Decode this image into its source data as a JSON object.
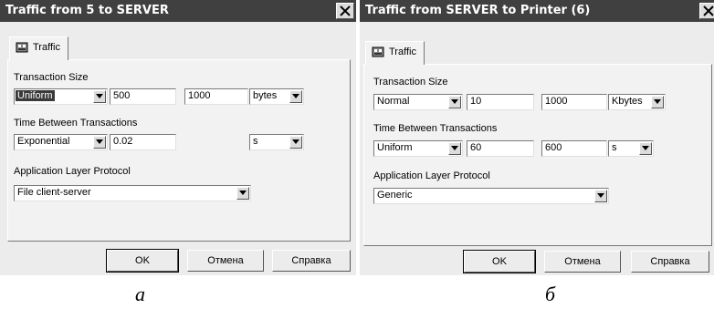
{
  "dialog_a": {
    "title": "Traffic from 5 to SERVER",
    "tab_label": "Traffic",
    "transaction_size_label": "Transaction Size",
    "size_distribution": "Uniform",
    "size_param1": "500",
    "size_param2": "1000",
    "size_unit": "bytes",
    "time_between_label": "Time Between Transactions",
    "time_distribution": "Exponential",
    "time_param1": "0.02",
    "time_unit": "s",
    "protocol_label": "Application Layer Protocol",
    "protocol_value": "File client-server",
    "ok_label": "OK",
    "cancel_label": "Отмена",
    "help_label": "Справка",
    "caption": "а"
  },
  "dialog_b": {
    "title": "Traffic from SERVER to Printer (6)",
    "tab_label": "Traffic",
    "transaction_size_label": "Transaction Size",
    "size_distribution": "Normal",
    "size_param1": "10",
    "size_param2": "1000",
    "size_unit": "Kbytes",
    "time_between_label": "Time Between Transactions",
    "time_distribution": "Uniform",
    "time_param1": "60",
    "time_param2": "600",
    "time_unit": "s",
    "protocol_label": "Application Layer Protocol",
    "protocol_value": "Generic",
    "ok_label": "OK",
    "cancel_label": "Отмена",
    "help_label": "Справка",
    "caption": "б"
  },
  "icons": {
    "close": "close-icon",
    "tab": "traffic-icon",
    "dropdown": "chevron-down-icon"
  }
}
